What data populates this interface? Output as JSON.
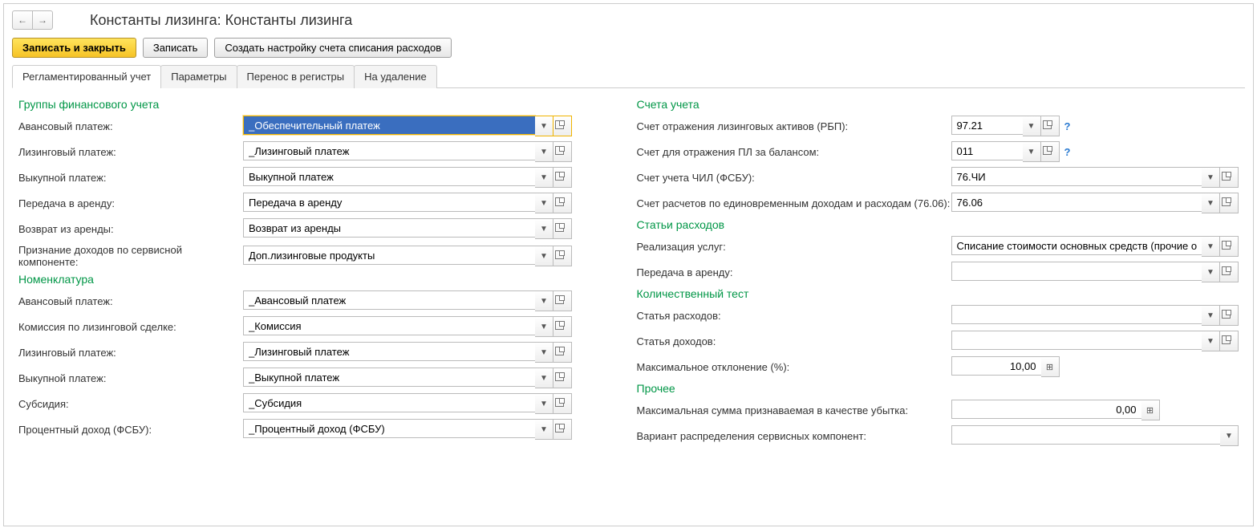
{
  "header": {
    "title": "Константы лизинга: Константы лизинга"
  },
  "actions": {
    "save_close": "Записать и закрыть",
    "save": "Записать",
    "create_setting": "Создать настройку счета списания расходов"
  },
  "tabs": {
    "reg": "Регламентированный учет",
    "params": "Параметры",
    "transfer": "Перенос в регистры",
    "delete": "На удаление"
  },
  "left": {
    "sect_groups": "Группы финансового учета",
    "advance": {
      "label": "Авансовый платеж:",
      "value": "_Обеспечительный платеж"
    },
    "leasing": {
      "label": "Лизинговый платеж:",
      "value": "_Лизинговый платеж"
    },
    "buyout": {
      "label": "Выкупной платеж:",
      "value": "Выкупной платеж"
    },
    "transfer": {
      "label": "Передача в аренду:",
      "value": "Передача в аренду"
    },
    "return": {
      "label": "Возврат из аренды:",
      "value": "Возврат из аренды"
    },
    "service": {
      "label": "Признание доходов по сервисной компоненте:",
      "value": "Доп.лизинговые продукты"
    },
    "sect_nom": "Номенклатура",
    "nom_advance": {
      "label": "Авансовый платеж:",
      "value": "_Авансовый платеж"
    },
    "nom_comm": {
      "label": "Комиссия по лизинговой сделке:",
      "value": "_Комиссия"
    },
    "nom_leasing": {
      "label": "Лизинговый платеж:",
      "value": "_Лизинговый платеж"
    },
    "nom_buyout": {
      "label": "Выкупной платеж:",
      "value": "_Выкупной платеж"
    },
    "nom_subsidy": {
      "label": "Субсидия:",
      "value": "_Субсидия"
    },
    "nom_interest": {
      "label": "Процентный доход (ФСБУ):",
      "value": "_Процентный доход (ФСБУ)"
    }
  },
  "right": {
    "sect_accounts": "Счета учета",
    "acc_rbp": {
      "label": "Счет отражения лизинговых активов (РБП):",
      "value": "97.21"
    },
    "acc_pl": {
      "label": "Счет для отражения ПЛ за балансом:",
      "value": "011"
    },
    "acc_chil": {
      "label": "Счет учета ЧИЛ (ФСБУ):",
      "value": "76.ЧИ"
    },
    "acc_7606": {
      "label": "Счет расчетов по единовременным доходам и расходам (76.06):",
      "value": "76.06"
    },
    "sect_exp": "Статьи расходов",
    "exp_real": {
      "label": "Реализация услуг:",
      "value": "Списание стоимости основных средств (прочие операц.)"
    },
    "exp_transfer": {
      "label": "Передача в аренду:",
      "value": ""
    },
    "sect_test": "Количественный тест",
    "test_exp": {
      "label": "Статья расходов:",
      "value": ""
    },
    "test_inc": {
      "label": "Статья доходов:",
      "value": ""
    },
    "test_dev": {
      "label": "Максимальное отклонение (%):",
      "value": "10,00"
    },
    "sect_other": "Прочее",
    "other_max": {
      "label": "Максимальная сумма признаваемая в качестве убытка:",
      "value": "0,00"
    },
    "other_dist": {
      "label": "Вариант распределения сервисных компонент:",
      "value": ""
    }
  },
  "help": "?"
}
